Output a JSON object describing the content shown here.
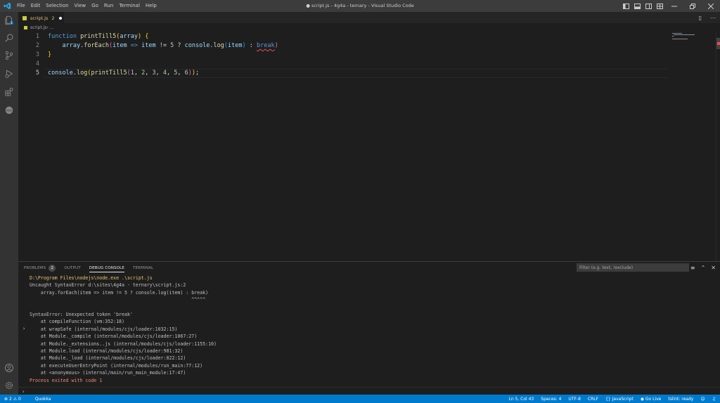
{
  "window": {
    "title": "● script.js - 4g4a - ternary - Visual Studio Code",
    "menu": [
      "File",
      "Edit",
      "Selection",
      "View",
      "Go",
      "Run",
      "Terminal",
      "Help"
    ]
  },
  "tab": {
    "name": "script.js",
    "problem_count": "2"
  },
  "breadcrumb": {
    "file": "script.js",
    "sep": " › ..."
  },
  "editor": {
    "line_numbers": [
      "1",
      "2",
      "3",
      "4",
      "5"
    ],
    "lines": [
      [
        {
          "t": "function ",
          "c": "k"
        },
        {
          "t": "printTill5",
          "c": "f"
        },
        {
          "t": "(",
          "c": "b1"
        },
        {
          "t": "array",
          "c": "v"
        },
        {
          "t": ")",
          "c": "b1"
        },
        {
          "t": " ",
          "c": "p"
        },
        {
          "t": "{",
          "c": "b1"
        }
      ],
      [
        {
          "t": "    ",
          "c": "p"
        },
        {
          "t": "array",
          "c": "v"
        },
        {
          "t": ".",
          "c": "p"
        },
        {
          "t": "forEach",
          "c": "f"
        },
        {
          "t": "(",
          "c": "b2"
        },
        {
          "t": "item",
          "c": "v"
        },
        {
          "t": " ",
          "c": "p"
        },
        {
          "t": "=>",
          "c": "k"
        },
        {
          "t": " ",
          "c": "p"
        },
        {
          "t": "item",
          "c": "v"
        },
        {
          "t": " != ",
          "c": "p"
        },
        {
          "t": "5",
          "c": "n"
        },
        {
          "t": " ? ",
          "c": "p"
        },
        {
          "t": "console",
          "c": "v"
        },
        {
          "t": ".",
          "c": "p"
        },
        {
          "t": "log",
          "c": "f"
        },
        {
          "t": "(",
          "c": "b3"
        },
        {
          "t": "item",
          "c": "v"
        },
        {
          "t": ")",
          "c": "b3"
        },
        {
          "t": " : ",
          "c": "p"
        },
        {
          "t": "break",
          "c": "k err"
        },
        {
          "t": ")",
          "c": "b2"
        }
      ],
      [
        {
          "t": "}",
          "c": "b1"
        }
      ],
      [],
      [
        {
          "t": "console",
          "c": "v"
        },
        {
          "t": ".",
          "c": "p"
        },
        {
          "t": "log",
          "c": "f"
        },
        {
          "t": "(",
          "c": "b1"
        },
        {
          "t": "printTill5",
          "c": "f"
        },
        {
          "t": "(",
          "c": "b2"
        },
        {
          "t": "1",
          "c": "n"
        },
        {
          "t": ", ",
          "c": "p"
        },
        {
          "t": "2",
          "c": "n"
        },
        {
          "t": ", ",
          "c": "p"
        },
        {
          "t": "3",
          "c": "n"
        },
        {
          "t": ", ",
          "c": "p"
        },
        {
          "t": "4",
          "c": "n"
        },
        {
          "t": ", ",
          "c": "p"
        },
        {
          "t": "5",
          "c": "n"
        },
        {
          "t": ", ",
          "c": "p"
        },
        {
          "t": "6",
          "c": "n"
        },
        {
          "t": ")",
          "c": "b2"
        },
        {
          "t": ")",
          "c": "b1"
        },
        {
          "t": ";",
          "c": "p"
        }
      ]
    ]
  },
  "panel": {
    "tabs": [
      {
        "label": "PROBLEMS",
        "badge": "2"
      },
      {
        "label": "OUTPUT"
      },
      {
        "label": "DEBUG CONSOLE",
        "active": true
      },
      {
        "label": "TERMINAL"
      }
    ],
    "filter_placeholder": "Filter (e.g. text, !exclude)",
    "console_lines": [
      {
        "text": "D:\\Program Files\\nodejs\\node.exe .\\script.js",
        "style": "warn"
      },
      {
        "text": "Uncaught SyntaxError d:\\sites\\4g4a - ternary\\script.js:2",
        "style": "gray"
      },
      {
        "text": "    array.forEach(item => item != 5 ? console.log(item) : break)",
        "style": "gray"
      },
      {
        "text": "                                                          ^^^^^",
        "style": "gray"
      },
      {
        "text": "",
        "style": "gray"
      },
      {
        "text": "SyntaxError: Unexpected token 'break'",
        "style": "gray"
      },
      {
        "text": "    at compileFunction (vm:352:18)",
        "style": "gray"
      },
      {
        "text": "    at wrapSafe (internal/modules/cjs/loader:1032:15)",
        "style": "gray",
        "chevron": true
      },
      {
        "text": "    at Module._compile (internal/modules/cjs/loader:1067:27)",
        "style": "gray"
      },
      {
        "text": "    at Module._extensions..js (internal/modules/cjs/loader:1155:10)",
        "style": "gray"
      },
      {
        "text": "    at Module.load (internal/modules/cjs/loader:981:32)",
        "style": "gray"
      },
      {
        "text": "    at Module._load (internal/modules/cjs/loader:822:12)",
        "style": "gray"
      },
      {
        "text": "    at executeUserEntryPoint (internal/modules/run_main:77:12)",
        "style": "gray"
      },
      {
        "text": "    at <anonymous> (internal/main/run_main_module:17:47)",
        "style": "gray"
      },
      {
        "text": "Process exited with code 1",
        "style": "red"
      }
    ],
    "prompt": "›"
  },
  "statusbar": {
    "errors": "2",
    "warnings": "0",
    "quokka": "Quokka",
    "position": "Ln 5, Col 43",
    "spaces": "Spaces: 4",
    "encoding": "UTF-8",
    "eol": "CRLF",
    "language": "JavaScript",
    "golive": "Go Live",
    "tslint": "tslint: ready"
  },
  "colors": {
    "statusbar": "#007acc",
    "titlebar": "#3c3c3c",
    "activitybar": "#333333",
    "editor": "#1e1e1e"
  }
}
